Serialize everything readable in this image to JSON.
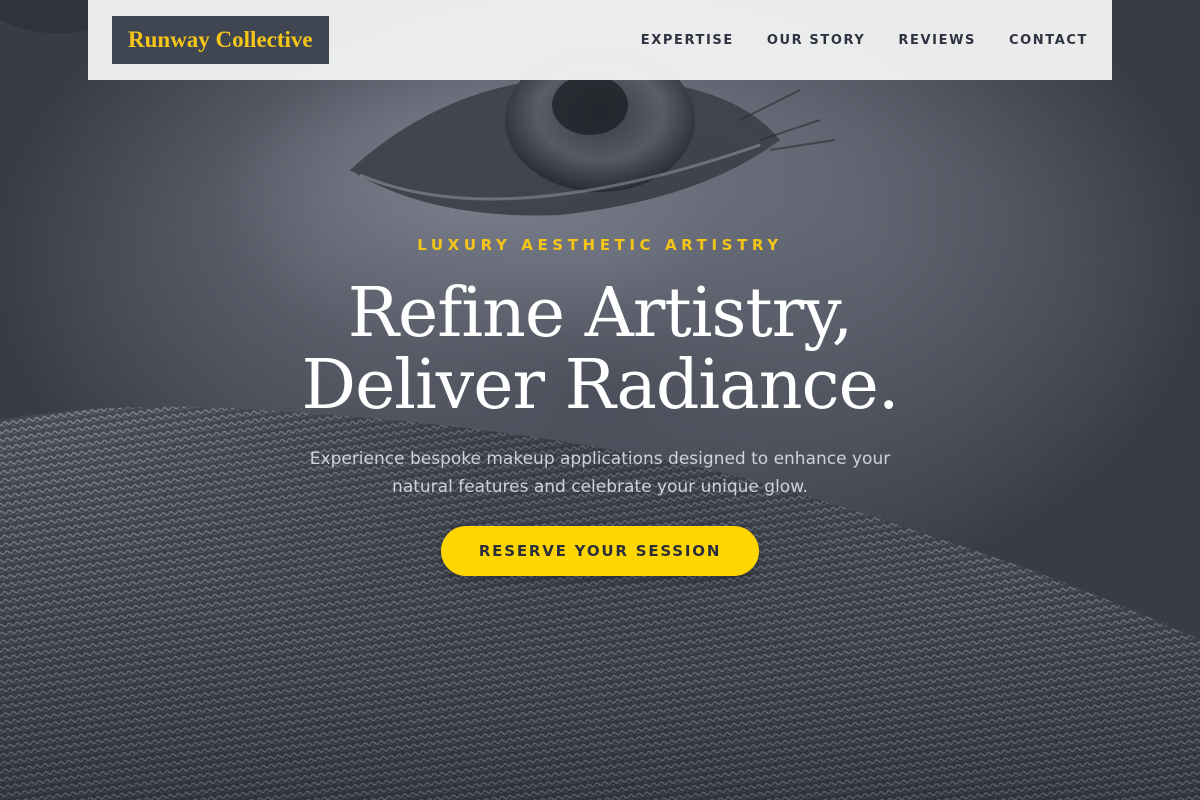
{
  "brand": {
    "name": "Runway Collective"
  },
  "nav": {
    "items": [
      {
        "label": "EXPERTISE"
      },
      {
        "label": "OUR STORY"
      },
      {
        "label": "REVIEWS"
      },
      {
        "label": "CONTACT"
      }
    ]
  },
  "hero": {
    "eyebrow": "LUXURY AESTHETIC ARTISTRY",
    "headline_line1": "Refine Artistry,",
    "headline_line2": "Deliver Radiance.",
    "subtext_line1": "Experience bespoke makeup applications designed to enhance your",
    "subtext_line2": "natural features and celebrate your unique glow.",
    "cta_label": "RESERVE YOUR SESSION",
    "background_image": "close-up of eye and knit hat"
  },
  "colors": {
    "accent": "#ffd600",
    "logo_text": "#f5c518",
    "logo_bg": "#3f4652",
    "header_bg": "#f1f1f1",
    "nav_text": "#2d3340"
  }
}
